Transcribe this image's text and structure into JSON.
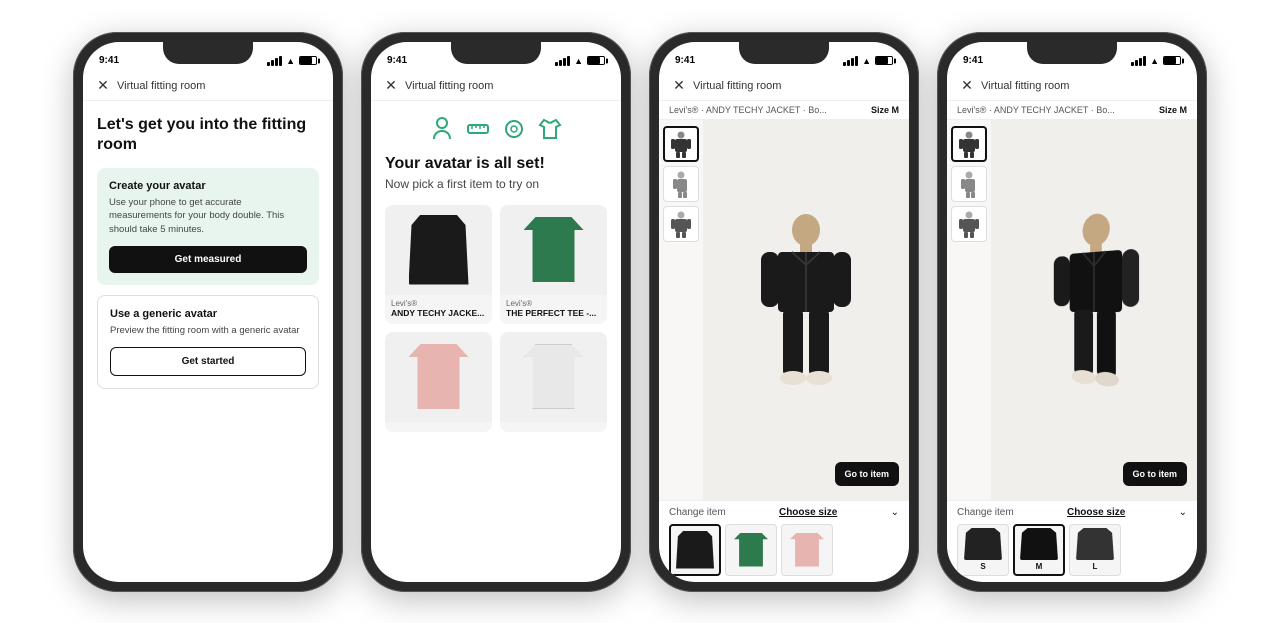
{
  "page": {
    "background": "#ffffff"
  },
  "phones": [
    {
      "id": "phone1",
      "status_bar": {
        "time": "9:41",
        "signal": "●●●",
        "wifi": "wifi",
        "battery": "battery"
      },
      "nav": {
        "close_label": "✕",
        "title": "Virtual fitting room"
      },
      "screen": {
        "type": "onboarding",
        "heading": "Let's get you into the fitting room",
        "card1": {
          "title": "Create your avatar",
          "description": "Use your phone to get accurate measurements for your body double. This should take 5 minutes.",
          "button_label": "Get measured"
        },
        "card2": {
          "title": "Use a generic avatar",
          "description": "Preview the fitting room with a generic avatar",
          "button_label": "Get started"
        }
      }
    },
    {
      "id": "phone2",
      "status_bar": {
        "time": "9:41"
      },
      "nav": {
        "close_label": "✕",
        "title": "Virtual fitting room"
      },
      "screen": {
        "type": "avatar-set",
        "heading": "Your avatar is all set!",
        "subheading": "Now pick a first item to try on",
        "products": [
          {
            "brand": "Levi's®",
            "name": "ANDY TECHY JACKE...",
            "type": "jacket-black"
          },
          {
            "brand": "Levi's®",
            "name": "THE PERFECT TEE -...",
            "type": "tshirt-green"
          },
          {
            "brand": "",
            "name": "",
            "type": "sweater-pink"
          },
          {
            "brand": "",
            "name": "",
            "type": "tshirt-white"
          }
        ]
      }
    },
    {
      "id": "phone3",
      "status_bar": {
        "time": "9:41"
      },
      "nav": {
        "close_label": "✕",
        "title": "Virtual fitting room"
      },
      "screen": {
        "type": "3d-view",
        "product_bar": {
          "name": "Levi's® · ANDY TECHY JACKET · Bo...",
          "size": "Size M"
        },
        "goto_label": "Go to item",
        "bottom": {
          "change_item": "Change item",
          "choose_size": "Choose size",
          "selected_item": 0,
          "items": [
            "jacket",
            "tshirt-green",
            "sweater-pink"
          ],
          "sizes": []
        }
      }
    },
    {
      "id": "phone4",
      "status_bar": {
        "time": "9:41"
      },
      "nav": {
        "close_label": "✕",
        "title": "Virtual fitting room"
      },
      "screen": {
        "type": "3d-size",
        "product_bar": {
          "name": "Levi's® · ANDY TECHY JACKET · Bo...",
          "size": "Size M"
        },
        "goto_label": "Go to item",
        "bottom": {
          "change_item": "Change item",
          "choose_size": "Choose size",
          "sizes": [
            "S",
            "M",
            "L"
          ],
          "selected_size": 1,
          "items": [
            "jacket-dark1",
            "jacket-dark2",
            "jacket-dark3"
          ]
        }
      }
    }
  ]
}
